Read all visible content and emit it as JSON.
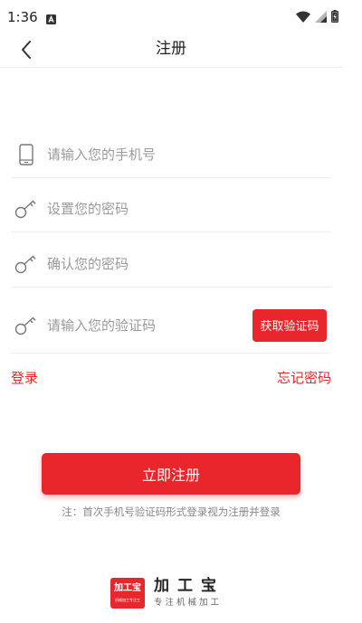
{
  "status_bar": {
    "time": "1:36",
    "notification_icon": "a-icon",
    "wifi_icon": "wifi-icon",
    "signal_icon": "signal-icon",
    "battery_icon": "battery-charging-icon"
  },
  "header": {
    "back_icon": "chevron-left-icon",
    "title": "注册"
  },
  "form": {
    "phone": {
      "icon": "phone-icon",
      "placeholder": "请输入您的手机号",
      "value": ""
    },
    "password": {
      "icon": "key-icon",
      "placeholder": "设置您的密码",
      "value": ""
    },
    "confirm_password": {
      "icon": "key-icon",
      "placeholder": "确认您的密码",
      "value": ""
    },
    "code": {
      "icon": "key-icon",
      "placeholder": "请输入您的验证码",
      "value": ""
    },
    "get_code_label": "获取验证码"
  },
  "links": {
    "login": "登录",
    "forgot_password": "忘记密码"
  },
  "register_label": "立即注册",
  "note": "注：首次手机号验证码形式登录视为注册并登录",
  "brand": {
    "logo_text": "加工宝",
    "logo_subtext": "机械加工专注工",
    "name": "加工宝",
    "slogan": "专注机械加工"
  },
  "colors": {
    "accent": "#e8262b",
    "placeholder": "#9a9a9a",
    "divider": "#eeeeee",
    "note": "#888888"
  }
}
